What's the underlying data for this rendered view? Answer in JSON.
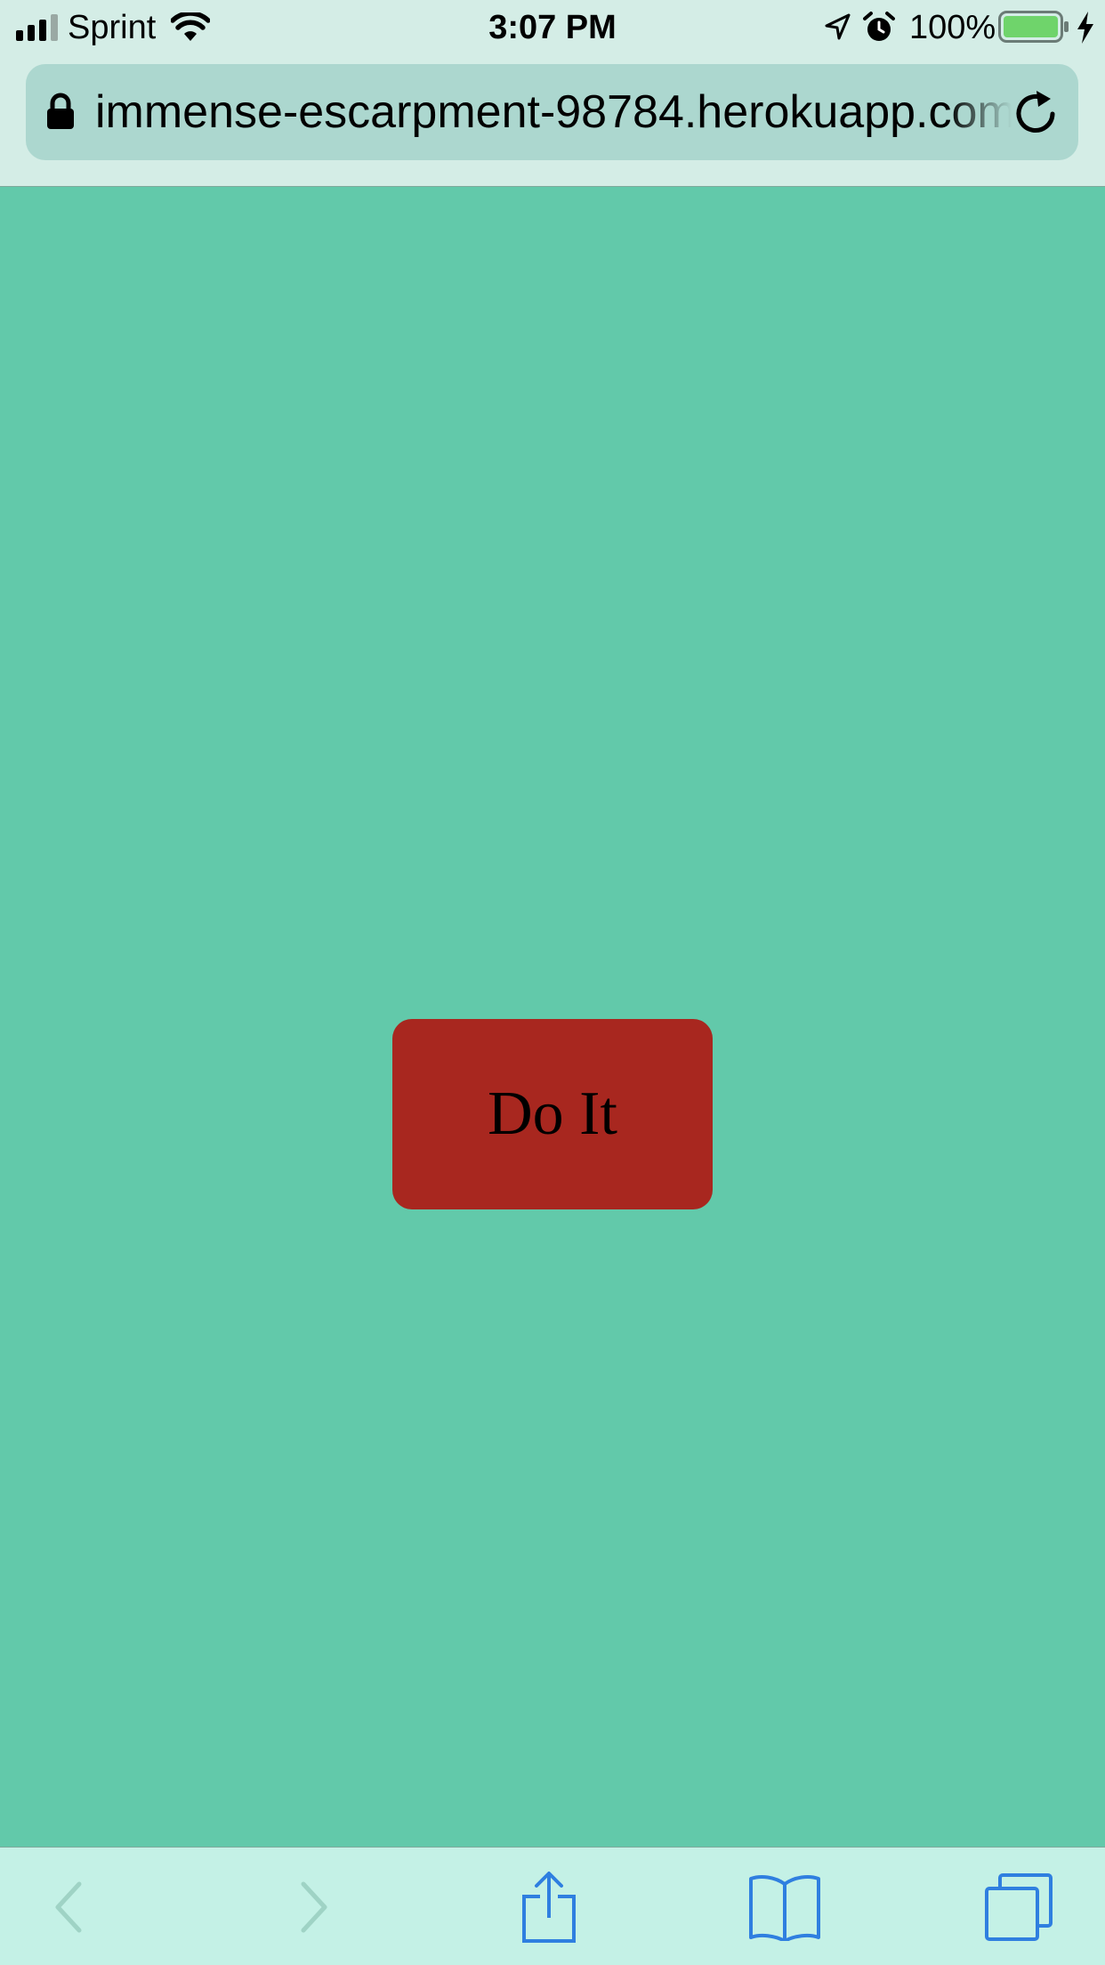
{
  "status_bar": {
    "carrier": "Sprint",
    "time": "3:07 PM",
    "battery_percent": "100%",
    "battery_level": 1.0,
    "icons": [
      "signal-icon",
      "wifi-icon",
      "location-icon",
      "alarm-icon",
      "battery-icon",
      "charging-icon"
    ]
  },
  "address_bar": {
    "url": "immense-escarpment-98784.herokuapp.com",
    "icons": [
      "lock-icon",
      "reload-icon"
    ]
  },
  "main": {
    "button_label": "Do It"
  },
  "toolbar": {
    "icons": [
      "back-chevron-icon",
      "forward-chevron-icon",
      "share-icon",
      "bookmarks-icon",
      "tabs-icon"
    ]
  },
  "colors": {
    "page_background": "#62c9aa",
    "button_background": "#a8271f",
    "chrome_background": "#d4ede6",
    "address_bar_background": "#acd7cf",
    "toolbar_background": "#c4f1e6",
    "toolbar_icon_active": "#2f7fe0",
    "toolbar_icon_disabled": "#9fd3c5",
    "battery_fill": "#6fd46b"
  }
}
